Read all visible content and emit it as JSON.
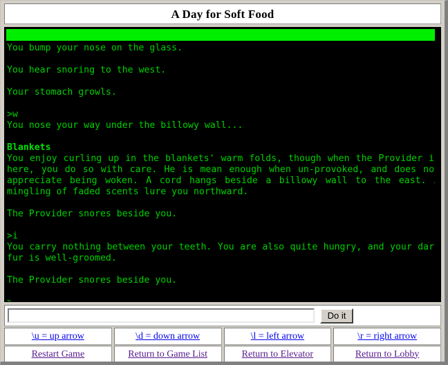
{
  "window": {
    "title": "A Day for Soft Food"
  },
  "status_bar": {
    "text": "",
    "color": "#00ee00"
  },
  "transcript": {
    "lines": [
      {
        "type": "text",
        "text": "You bump your nose on the glass."
      },
      {
        "type": "blank",
        "text": ""
      },
      {
        "type": "text",
        "text": "You hear snoring to the west."
      },
      {
        "type": "blank",
        "text": ""
      },
      {
        "type": "text",
        "text": "Your stomach growls."
      },
      {
        "type": "blank",
        "text": ""
      },
      {
        "type": "prompt",
        "text": ">w"
      },
      {
        "type": "text",
        "text": "You nose your way under the billowy wall..."
      },
      {
        "type": "blank",
        "text": ""
      },
      {
        "type": "head",
        "text": "Blankets"
      },
      {
        "type": "para",
        "text": "You enjoy curling up in the blankets' warm folds, though when the Provider is here, you do so with care. He is mean enough when un-provoked, and does not appreciate being woken. A cord hangs beside a billowy wall to the east. A mingling of faded scents lure you northward."
      },
      {
        "type": "blank",
        "text": ""
      },
      {
        "type": "text",
        "text": "The Provider snores beside you."
      },
      {
        "type": "blank",
        "text": ""
      },
      {
        "type": "prompt",
        "text": ">i"
      },
      {
        "type": "para",
        "text": "You carry nothing between your teeth. You are also quite hungry, and your dark fur is well-groomed."
      },
      {
        "type": "blank",
        "text": ""
      },
      {
        "type": "text",
        "text": "The Provider snores beside you."
      },
      {
        "type": "blank",
        "text": ""
      },
      {
        "type": "prompt",
        "text": ">_"
      }
    ],
    "text_color": "#00d000",
    "background": "#000000"
  },
  "command": {
    "value": "",
    "placeholder": "",
    "submit_label": "Do it"
  },
  "nav_rows": [
    {
      "state": "unvisited",
      "links": [
        {
          "label": "\\u = up arrow"
        },
        {
          "label": "\\d = down arrow"
        },
        {
          "label": "\\l = left arrow"
        },
        {
          "label": "\\r = right arrow"
        }
      ]
    },
    {
      "state": "visited",
      "links": [
        {
          "label": "Restart Game"
        },
        {
          "label": "Return to Game List"
        },
        {
          "label": "Return to Elevator"
        },
        {
          "label": "Return to Lobby"
        }
      ]
    }
  ],
  "colors": {
    "link_unvisited": "#0000ee",
    "link_visited": "#551a8b",
    "status_green": "#00ee00",
    "console_text": "#00d000",
    "console_bg": "#000000",
    "chrome": "#d4d0c8"
  }
}
